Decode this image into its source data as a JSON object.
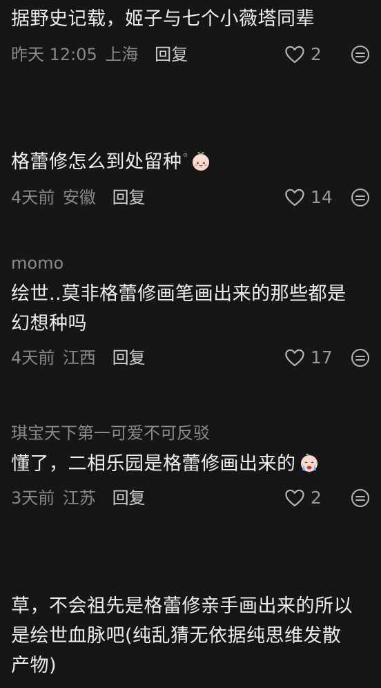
{
  "comments": [
    {
      "username": "",
      "content": "据野史记载，姬子与七个小薇塔同辈",
      "time": "昨天 12:05",
      "location": "上海",
      "reply": "回复",
      "likes": "2"
    },
    {
      "username": "",
      "content": "格蕾修怎么到处留种",
      "time": "4天前",
      "location": "安徽",
      "reply": "回复",
      "likes": "14"
    },
    {
      "username": "momo",
      "content_line1": "绘世..莫非格蕾修画笔画出来的那些都是",
      "content_line2": "幻想种吗",
      "time": "4天前",
      "location": "江西",
      "reply": "回复",
      "likes": "17"
    },
    {
      "username": "琪宝天下第一可爱不可反驳",
      "content": "懂了，二相乐园是格蕾修画出来的",
      "time": "3天前",
      "location": "江苏",
      "reply": "回复",
      "likes": "2"
    },
    {
      "username": "",
      "content_line1": "草，不会祖先是格蕾修亲手画出来的所以",
      "content_line2": "是绘世血脉吧(纯乱猜无依据纯思维发散",
      "content_line3": "产物)"
    }
  ],
  "icons": {
    "like": "heart-outline-icon",
    "more": "more-options-icon",
    "emoji_smile": "peach-face-emoji",
    "emoji_cry": "crying-face-emoji"
  },
  "colors": {
    "background": "#161616",
    "text_primary": "#ededed",
    "text_secondary": "#888888"
  }
}
